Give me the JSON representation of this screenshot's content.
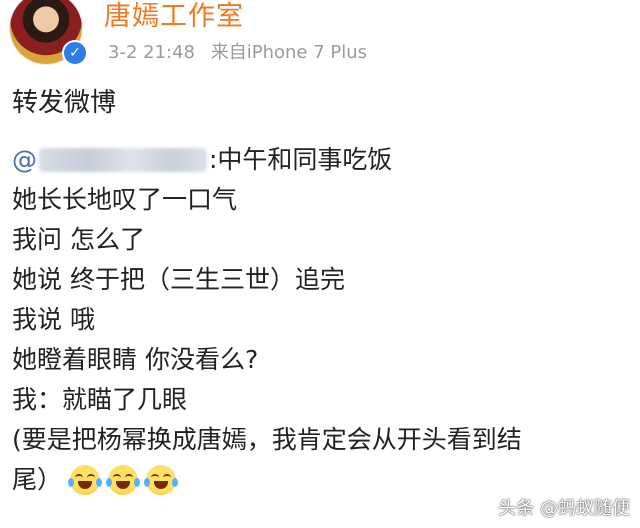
{
  "header": {
    "username": "唐嫣工作室",
    "timestamp": "3-2 21:48",
    "source": "来自iPhone 7 Plus",
    "verified_icon": "verified-check-icon",
    "accent_color": "#f07a20",
    "verified_color": "#2f7ee8"
  },
  "post": {
    "repost_label": "转发微博",
    "mention_prefix": "@",
    "mention_suffix": ":中午和同事吃饭",
    "lines": [
      "她长长地叹了一口气",
      "我问 怎么了",
      "她说 终于把（三生三世）追完",
      "我说 哦",
      "她瞪着眼睛 你没看么?",
      "我：就瞄了几眼",
      "(要是把杨幂换成唐嫣，我肯定会从开头看到结",
      "尾）"
    ],
    "emoji_icon": "laughing-crying-emoji-icon"
  },
  "watermark": {
    "text": "头条 @蚂蚁随便"
  }
}
